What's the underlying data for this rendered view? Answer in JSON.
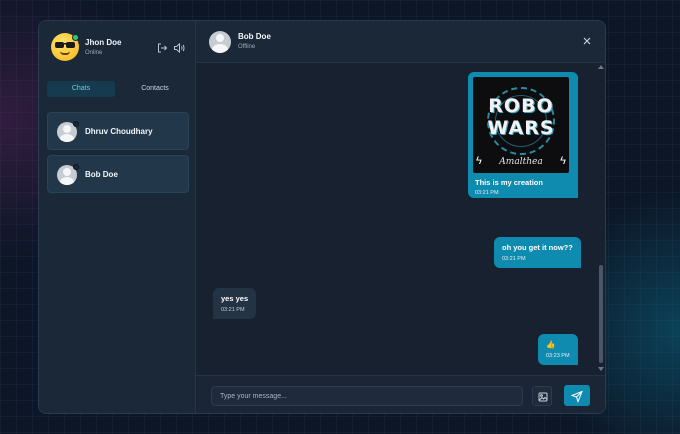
{
  "sidebar": {
    "profile": {
      "name": "Jhon Doe",
      "status": "Online",
      "avatar": "sunglasses-emoji"
    },
    "actions": [
      {
        "icon": "logout-icon"
      },
      {
        "icon": "speaker-icon"
      }
    ],
    "tabs": [
      {
        "label": "Chats",
        "active": true
      },
      {
        "label": "Contacts",
        "active": false
      }
    ],
    "contacts": [
      {
        "name": "Dhruv Choudhary"
      },
      {
        "name": "Bob Doe"
      }
    ]
  },
  "chat": {
    "header": {
      "name": "Bob Doe",
      "status": "Offline",
      "close_icon": "close-icon"
    },
    "messages": [
      {
        "direction": "sent",
        "type": "image",
        "image_text": {
          "line1": "ROBO",
          "line2": "WARS",
          "signature": "Amalthea"
        },
        "text": "This is my creation",
        "time": "03:21 PM"
      },
      {
        "direction": "sent",
        "type": "text",
        "text": "oh you get it now??",
        "time": "03:21 PM"
      },
      {
        "direction": "received",
        "type": "text",
        "text": "yes yes",
        "time": "03:21 PM"
      },
      {
        "direction": "sent",
        "type": "text",
        "text": "👍",
        "time": "03:23 PM"
      }
    ],
    "composer": {
      "placeholder": "Type your message...",
      "image_icon": "image-icon",
      "send_icon": "send-icon"
    }
  },
  "colors": {
    "accent": "#0f8bb0",
    "online": "#2ecc71",
    "panel": "#1a2535"
  }
}
